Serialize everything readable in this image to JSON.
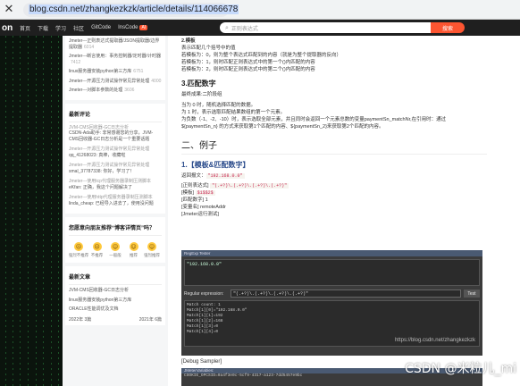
{
  "browser": {
    "close_glyph": "✕",
    "url": "blog.csdn.net/zhangkezkzk/article/details/114066678"
  },
  "topnav": {
    "brand": "on",
    "items": [
      "首页",
      "下载",
      "学习",
      "社区",
      "GitCode",
      "InsCode"
    ],
    "badge": "AI",
    "search_placeholder": "正则表达式",
    "search_button": "搜索",
    "search_icon": "search-icon"
  },
  "sidebar": {
    "recent_articles": [
      {
        "title": "Jmeter---正则表达式提取器/JSON提取器/边界提取器",
        "meta": "6014"
      },
      {
        "title": "Jmeter---断言使用：事务控制器/定时器/计时器",
        "meta": "7412"
      },
      {
        "title": "linux服务器安装python第三方库",
        "meta": "6751"
      },
      {
        "title": "Jmeter---开源压力测试操作常见异常处理",
        "meta": "4000"
      },
      {
        "title": "Jmeter---对脚本参数的处理",
        "meta": "3606"
      }
    ],
    "comments_title": "最新评论",
    "comments": [
      {
        "who": "JVM-CMS回收器-GC日志分析",
        "text": "CSDN-Ada助手: 非常感谢您的分享，JVM-CMS回收器-GC日志分析是一个重要话题"
      },
      {
        "who": "Jmeter---开源压力测试操作常见异常处理",
        "text": "qq_41268023: 真棒，收藏啦"
      },
      {
        "who": "Jmeter---开源压力测试操作常见异常处理",
        "text": "smal_37787338: 你好，学习了！"
      },
      {
        "who": "Jmeter---使用tcp代理服务器录制压测脚本",
        "text": "eKfan: 正确，我这个问题解决了"
      },
      {
        "who": "Jmeter---使用http代理服务器录制压测脚本",
        "text": "linda_cheap: 已经导入进去了，使用没问题"
      }
    ],
    "feedback_title": "您愿意向朋友推荐“博客详情页”吗？",
    "emojis": [
      {
        "face": "☹",
        "label": "强烈不推荐"
      },
      {
        "face": "☹",
        "label": "不推荐"
      },
      {
        "face": "☺",
        "label": "一般般"
      },
      {
        "face": "☺",
        "label": "推荐"
      },
      {
        "face": "☺",
        "label": "强烈推荐"
      }
    ],
    "latest_title": "最新文章",
    "latest": [
      "JVM-CMS回收器-GC日志分析",
      "linux服务器安装python第三方库",
      "ORACLE性能调优及文档"
    ],
    "archive": [
      {
        "year": "2022年",
        "count": "3篇"
      },
      {
        "year": "2021年",
        "count": "6篇"
      }
    ]
  },
  "main": {
    "intro_lines": [
      "2.模板",
      "表示匹配几个括号中的值",
      "若模板为：0，则为整个表达式匹配到的内容（就是为整个提取器的反向）",
      "若模板为：1，则时匹配正则表达式中的第一个()内匹配的内容",
      "若模板为：2，则时匹配正则表达式中的第二个()内匹配的内容"
    ],
    "h3_match_num": "3.匹配数字",
    "match_num_desc": "最终成果:二阶段组",
    "match_num_lines": [
      "当为 0 时，随机选择匹配的数据。",
      "为 1 时，表示选取匹配结果数组的第一个元素。",
      "为负数（-1、-2、-10）时，表示选取全部元素，并且同时会返回一个元素总数的变量paymentSn_matchNr,在引用时：通过",
      "${paymentSn_n} 的方式来获取第1个匹配的内容、${paymentSn_2}来获取第2个匹配的内容。"
    ],
    "h2_example": "二、例子",
    "h3_example": "1.【模板&匹配数字】",
    "sample_label": "返回报文：",
    "sample_code": "\"192.168.0.0\"",
    "regex_label": "[正则表达式]",
    "regex_code": "\"(.+?)\\.(.+?)\\.(.+?)\\.(.+?)\"",
    "template_label": "[模板]",
    "template_code": "$1$$2$",
    "matchno_label": "[匹配数字]",
    "matchno_value": "1",
    "varname_label": "[变量名]",
    "varname_value": "remoteAddr",
    "debug_label": "[Jmeter运行测试]",
    "tester": {
      "bar": "RegExp Tester",
      "text": "\"192.168.0.0\"",
      "expr_label": "Regular expression:",
      "expr_value": "\"(.+?)\\.(.+?)\\.(.+?)\\.(.+?)\"",
      "test_btn": "Test",
      "results": [
        "Match count: 1",
        "Match[1][0]=\"192.168.0.0\"",
        "Match[1][1]=192",
        "Match[1][2]=168",
        "Match[1][3]=0",
        "Match[1][4]=0"
      ],
      "watermark": "https://blog.csdn.net/zhangkezkzk"
    },
    "debug_sampler": "[Debug Sampler]",
    "tester2": {
      "bar": "JMeterVariables:",
      "line": "COOKIE_OPCSID=0a4f3e0c-5cf9-4317-a123-7dd5457e9bc"
    }
  },
  "watermark": "CSDN @米粒儿_mi"
}
